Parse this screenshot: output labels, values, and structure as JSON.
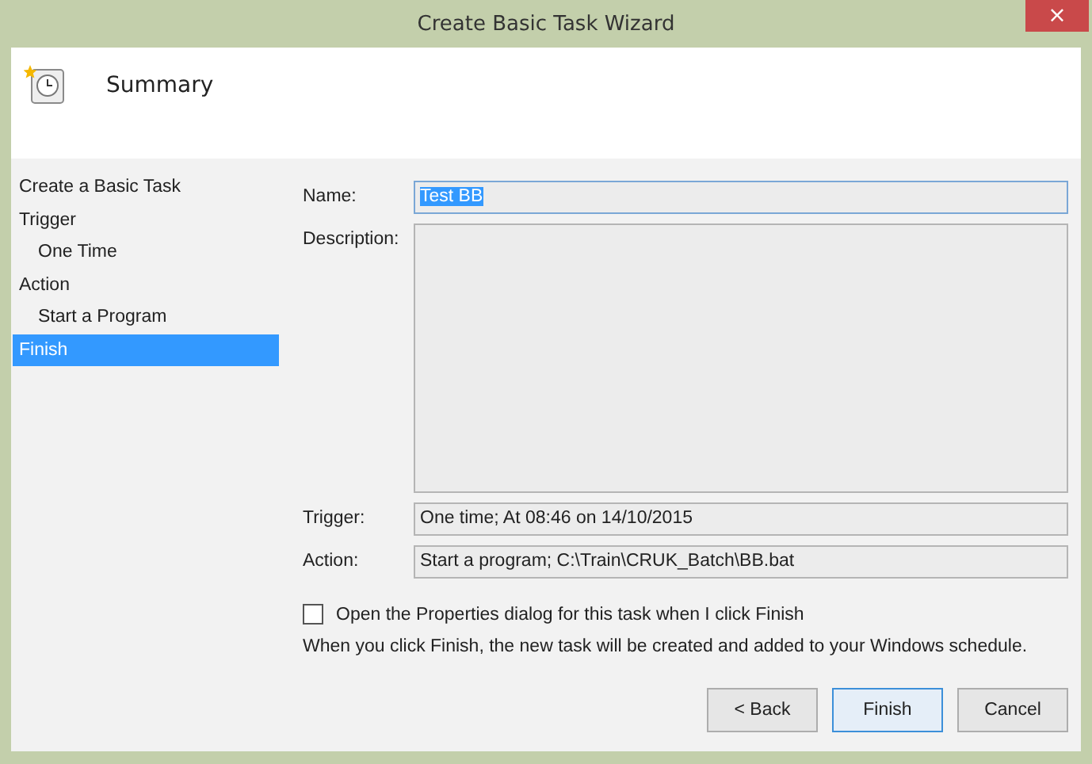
{
  "window": {
    "title": "Create Basic Task Wizard",
    "close": "×"
  },
  "header": {
    "title": "Summary"
  },
  "steps": [
    {
      "label": "Create a Basic Task",
      "selected": false
    },
    {
      "label": "Trigger",
      "selected": false,
      "children": [
        {
          "label": "One Time",
          "selected": false
        }
      ]
    },
    {
      "label": "Action",
      "selected": false,
      "children": [
        {
          "label": "Start a Program",
          "selected": false
        }
      ]
    },
    {
      "label": "Finish",
      "selected": true
    }
  ],
  "form": {
    "name_label": "Name:",
    "name_value": "Test BB",
    "name_value_highlighted": true,
    "description_label": "Description:",
    "trigger_label": "Trigger:",
    "trigger_value": "One time; At 08:46 on 14/10/2015",
    "action_label": "Action:",
    "action_value": "Start a program; C:\\Train\\CRUK_Batch\\BB.bat"
  },
  "open_properties": {
    "label": "Open the Properties dialog for this task when I click Finish",
    "checked": false
  },
  "note": "When you click Finish, the new task will be created and added to your Windows schedule.",
  "buttons": [
    {
      "label": "< Back",
      "default": false
    },
    {
      "label": "Finish",
      "default": true
    },
    {
      "label": "Cancel",
      "default": false
    }
  ]
}
